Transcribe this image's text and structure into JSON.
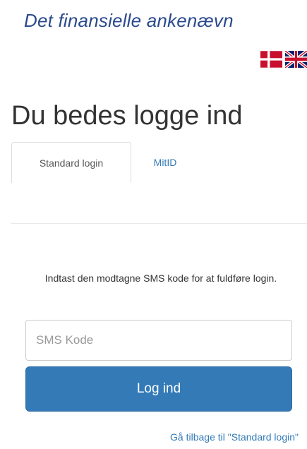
{
  "header": {
    "brand_text": "Det finansielle ankenævn"
  },
  "language": {
    "options": [
      {
        "icon": "danish-flag-icon"
      },
      {
        "icon": "uk-flag-icon"
      }
    ]
  },
  "login": {
    "title": "Du bedes logge ind",
    "tabs": [
      {
        "label": "Standard login",
        "active": true
      },
      {
        "label": "MitID",
        "active": false
      }
    ],
    "instructions": "Indtast den modtagne SMS kode for at fuldføre login.",
    "sms_input": {
      "value": "",
      "placeholder": "SMS Kode"
    },
    "submit_label": "Log ind",
    "back_link": "Gå tilbage til \"Standard login\""
  },
  "colors": {
    "brand": "#2a4a8c",
    "primary_button": "#337ab7",
    "link": "#337ab7",
    "danish_red": "#c8102e",
    "uk_blue": "#012169"
  }
}
